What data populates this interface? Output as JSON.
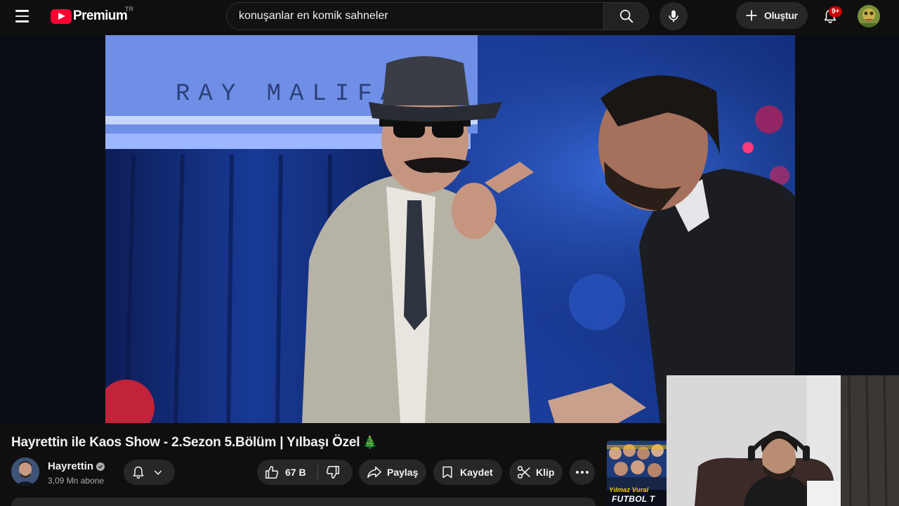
{
  "header": {
    "logo_text": "Premium",
    "country_code": "TR",
    "search_value": "konuşanlar en komik sahneler",
    "create_label": "Oluştur",
    "notification_badge": "9+"
  },
  "video": {
    "title": "Hayrettin ile Kaos Show - 2.Sezon 5.Bölüm | Yılbaşı Özel",
    "title_emoji": "🎄",
    "backdrop_text": "RAY MALIFA"
  },
  "channel": {
    "name": "Hayrettin",
    "subscribers": "3,09 Mn abone"
  },
  "actions": {
    "like_count": "67 B",
    "share_label": "Paylaş",
    "save_label": "Kaydet",
    "clip_label": "Klip"
  },
  "sidebar_preview": {
    "name_line": "Yılmaz Vural",
    "title_line": "FUTBOL T"
  },
  "colors": {
    "background": "#0f0f0f",
    "brand_red": "#ff0033",
    "pill_bg": "#272727",
    "badge_red": "#cc0000"
  },
  "icons": [
    "menu-icon",
    "youtube-logo-icon",
    "search-icon",
    "mic-icon",
    "plus-icon",
    "bell-icon",
    "chevron-down-icon",
    "thumbs-up-icon",
    "thumbs-down-icon",
    "share-icon",
    "bookmark-icon",
    "scissors-icon",
    "more-icon",
    "verified-icon"
  ]
}
